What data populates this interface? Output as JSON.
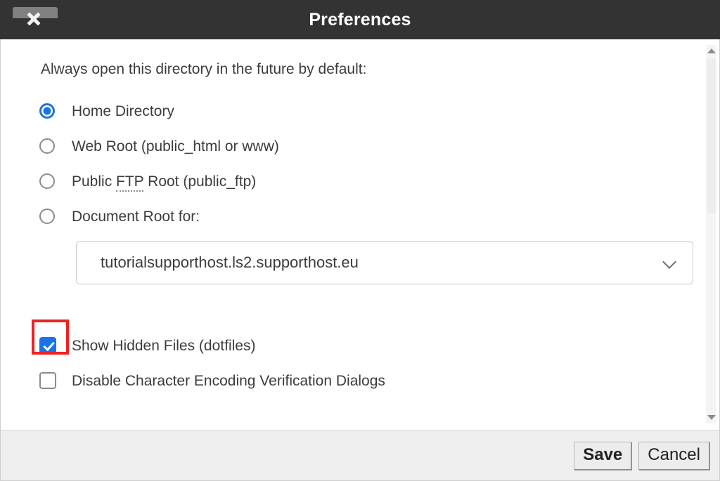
{
  "titlebar": {
    "title": "Preferences",
    "close_icon": "close-icon"
  },
  "content": {
    "intro": "Always open this directory in the future by default:",
    "radio_options": [
      {
        "label": "Home Directory",
        "selected": true
      },
      {
        "label": "Web Root (public_html or www)",
        "selected": false
      },
      {
        "label_before": "Public ",
        "abbr": "FTP",
        "label_after": " Root (public_ftp)",
        "selected": false
      },
      {
        "label": "Document Root for:",
        "selected": false
      }
    ],
    "select": {
      "value": "tutorialsupporthost.ls2.supporthost.eu",
      "icon": "chevron-down-icon"
    },
    "checkboxes": [
      {
        "label": "Show Hidden Files (dotfiles)",
        "checked": true,
        "highlighted": true
      },
      {
        "label": "Disable Character Encoding Verification Dialogs",
        "checked": false,
        "highlighted": false
      }
    ]
  },
  "scrollbar": {
    "up_icon": "triangle-up-icon",
    "down_icon": "triangle-down-icon"
  },
  "footer": {
    "save_label": "Save",
    "cancel_label": "Cancel"
  },
  "colors": {
    "titlebar_bg": "#333333",
    "accent_blue": "#1a73e8",
    "highlight_red": "#ee2222",
    "footer_bg": "#efefef",
    "text": "#3c3c3c"
  }
}
